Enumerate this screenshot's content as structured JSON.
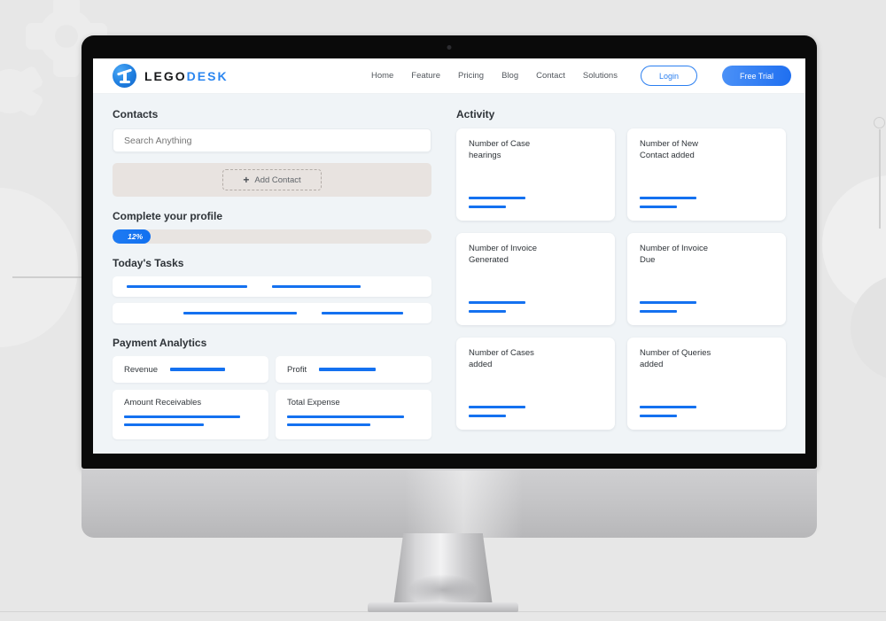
{
  "site": {
    "brand_primary": "LEGO",
    "brand_secondary": "DESK",
    "accent_color": "#1471f0",
    "nav": [
      {
        "label": "Home"
      },
      {
        "label": "Feature"
      },
      {
        "label": "Pricing"
      },
      {
        "label": "Blog"
      },
      {
        "label": "Contact"
      },
      {
        "label": "Solutions"
      }
    ],
    "login_label": "Login",
    "trial_label": "Free Trial"
  },
  "contacts": {
    "title": "Contacts",
    "search_placeholder": "Search Anything",
    "search_value": "",
    "add_contact_label": "Add Contact",
    "add_icon": "plus-icon"
  },
  "profile": {
    "title": "Complete your profile",
    "percent_label": "12%",
    "percent_value": 12
  },
  "tasks": {
    "title": "Today's Tasks",
    "rows": [
      {
        "bars": [
          136,
          100
        ]
      },
      {
        "bars": [
          128,
          92
        ]
      }
    ]
  },
  "payment_analytics": {
    "title": "Payment Analytics",
    "cards": [
      {
        "label": "Revenue",
        "type": "inline",
        "bars": [
          62
        ]
      },
      {
        "label": "Profit",
        "type": "inline",
        "bars": [
          64
        ]
      },
      {
        "label": "Amount Receivables",
        "type": "stacked",
        "bars": [
          131,
          90
        ]
      },
      {
        "label": "Total Expense",
        "type": "stacked",
        "bars": [
          132,
          94
        ]
      }
    ]
  },
  "activity": {
    "title": "Activity",
    "cards": [
      {
        "label": "Number of Case\nhearings",
        "bars": [
          64,
          42
        ]
      },
      {
        "label": "Number of New\nContact added",
        "bars": [
          64,
          42
        ]
      },
      {
        "label": "Number of Invoice\nGenerated",
        "bars": [
          64,
          42
        ]
      },
      {
        "label": "Number of Invoice\nDue",
        "bars": [
          64,
          42
        ]
      },
      {
        "label": "Number of Cases\nadded",
        "bars": [
          64,
          42
        ]
      },
      {
        "label": "Number of Queries\nadded",
        "bars": [
          64,
          42
        ]
      }
    ]
  }
}
